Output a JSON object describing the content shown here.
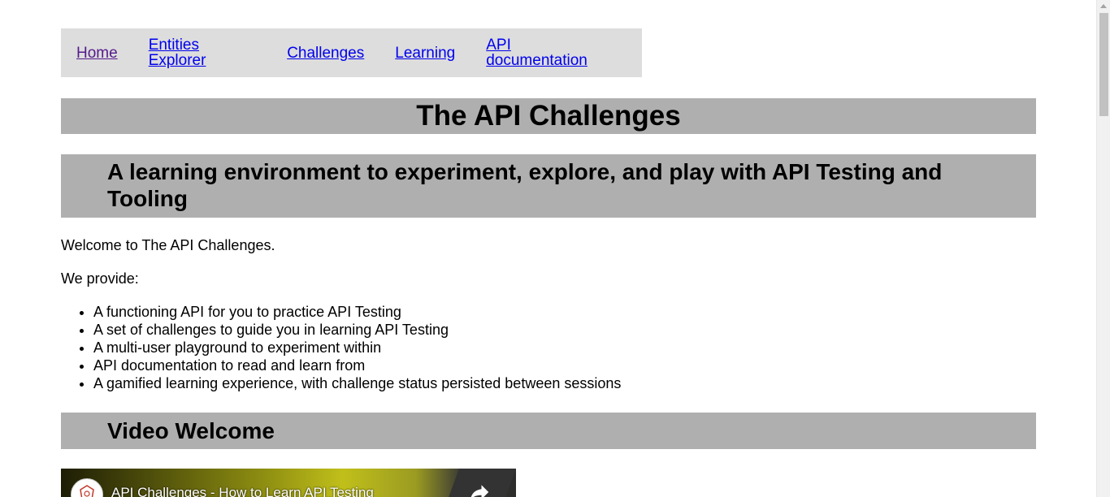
{
  "nav": {
    "items": [
      {
        "label": "Home"
      },
      {
        "label": "Entities Explorer"
      },
      {
        "label": "Challenges"
      },
      {
        "label": "Learning"
      },
      {
        "label": "API documentation"
      }
    ]
  },
  "header": {
    "title": "The API Challenges",
    "subtitle": "A learning environment to experiment, explore, and play with API Testing and Tooling"
  },
  "intro": {
    "welcome": "Welcome to The API Challenges.",
    "provide": "We provide:",
    "features": [
      "A functioning API for you to practice API Testing",
      "A set of challenges to guide you in learning API Testing",
      "A multi-user playground to experiment within",
      "API documentation to read and learn from",
      "A gamified learning experience, with challenge status persisted between sessions"
    ]
  },
  "video_section": {
    "heading": "Video Welcome",
    "video_title": "API Challenges - How to Learn API Testing"
  },
  "colors": {
    "nav_bg": "#dddddd",
    "banner_bg": "#afafaf",
    "link": "#0000ee",
    "link_visited": "#551a8b"
  },
  "icons": {
    "share": "share-icon",
    "channel": "channel-avatar-icon"
  }
}
